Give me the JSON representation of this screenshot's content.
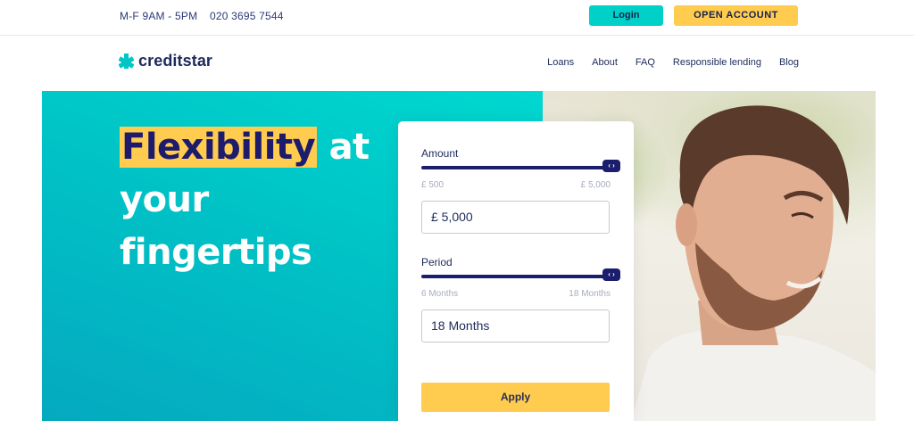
{
  "topbar": {
    "hours": "M-F 9AM - 5PM",
    "phone": "020 3695 7544",
    "login_label": "Login",
    "open_account_label": "OPEN ACCOUNT"
  },
  "brand": {
    "name": "creditstar",
    "icon": "star-cross-icon",
    "accent": "#00c6c6",
    "highlight": "#ffcc50",
    "navy": "#1d1b6b"
  },
  "nav": {
    "items": [
      {
        "label": "Loans"
      },
      {
        "label": "About"
      },
      {
        "label": "FAQ"
      },
      {
        "label": "Responsible lending"
      },
      {
        "label": "Blog"
      }
    ]
  },
  "hero": {
    "headline_highlight": "Flexibility",
    "headline_rest_1": " at",
    "headline_line_2": "your",
    "headline_line_3": "fingertips"
  },
  "calculator": {
    "amount": {
      "label": "Amount",
      "min_label": "£ 500",
      "max_label": "£ 5,000",
      "value": "£ 5,000",
      "slider_fraction": 1.0
    },
    "period": {
      "label": "Period",
      "min_label": "6 Months",
      "max_label": "18 Months",
      "value": "18 Months",
      "slider_fraction": 1.0
    },
    "apply_label": "Apply"
  }
}
